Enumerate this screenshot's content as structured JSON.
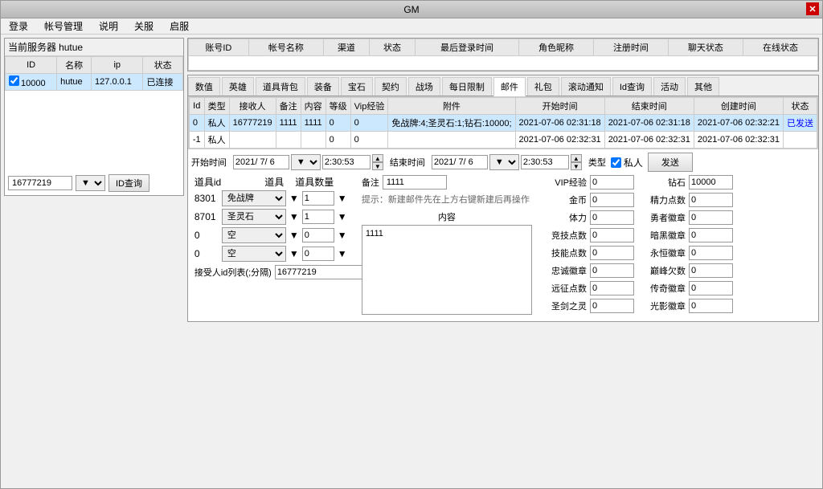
{
  "window": {
    "title": "GM",
    "close_label": "✕"
  },
  "menu": {
    "items": [
      "登录",
      "帐号管理",
      "说明",
      "关服",
      "启服"
    ]
  },
  "left_panel": {
    "server_label": "当前服务器",
    "server_value": "hutue",
    "table": {
      "headers": [
        "ID",
        "名称",
        "ip",
        "状态"
      ],
      "rows": [
        {
          "id": "10000",
          "name": "hutue",
          "ip": "127.0.0.1",
          "status": "已连接"
        }
      ]
    },
    "id_value": "16777219",
    "query_btn": "ID查询"
  },
  "tabs": {
    "items": [
      "数值",
      "英雄",
      "道具背包",
      "装备",
      "宝石",
      "契约",
      "战场",
      "每日限制",
      "邮件",
      "礼包",
      "滚动通知",
      "Id查询",
      "活动",
      "其他"
    ],
    "active": "邮件"
  },
  "mail_table": {
    "headers": [
      "Id",
      "类型",
      "接收人",
      "备注",
      "内容",
      "等级",
      "Vip经验",
      "附件",
      "开始时间",
      "结束时间",
      "创建时间",
      "状态"
    ],
    "rows": [
      {
        "id": "0",
        "type": "私人",
        "receiver": "16777219",
        "remark": "1111",
        "content": "1111",
        "level": "0",
        "vip_exp": "0",
        "attachment": "免战牌:4;圣灵石:1;钻石:10000;",
        "start_time": "2021-07-06 02:31:18",
        "end_time": "2021-07-06 02:31:18",
        "create_time": "2021-07-06 02:32:21",
        "status": "已发送",
        "selected": true
      },
      {
        "id": "-1",
        "type": "私人",
        "receiver": "",
        "remark": "",
        "content": "",
        "level": "0",
        "vip_exp": "0",
        "attachment": "",
        "start_time": "2021-07-06 02:32:31",
        "end_time": "2021-07-06 02:32:31",
        "create_time": "2021-07-06 02:32:31",
        "status": "",
        "selected": false
      }
    ]
  },
  "accounts_table": {
    "headers": [
      "账号ID",
      "帐号名称",
      "渠道",
      "状态",
      "最后登录时间",
      "角色昵称",
      "注册时间",
      "聊天状态",
      "在线状态"
    ]
  },
  "form": {
    "start_time_label": "开始时间",
    "start_date": "2021/ 7/ 6",
    "start_time": "2:30:53",
    "end_time_label": "结束时间",
    "end_date": "2021/ 7/ 6",
    "end_time": "2:30:53",
    "type_label": "类型",
    "private_label": "私人",
    "send_btn": "发送",
    "items_label": "道具id",
    "items_col2": "道具",
    "items_col3": "道具数量",
    "remark_label": "备注",
    "remark_value": "1111",
    "hint": "提示：新建邮件先在上方右键新建后再操作",
    "content_label": "内容",
    "content_value": "1111",
    "recipients_label": "接受人id列表(;分隔)",
    "recipients_value": "16777219",
    "items": [
      {
        "id": "8301",
        "name": "免战牌",
        "count": "1"
      },
      {
        "id": "8701",
        "name": "圣灵石",
        "count": "1"
      },
      {
        "id": "0",
        "name": "空",
        "count": "0"
      },
      {
        "id": "0",
        "name": "空",
        "count": "0"
      }
    ]
  },
  "stats": {
    "vip_exp_label": "VIP经验",
    "vip_exp_value": "0",
    "diamond_label": "钻石",
    "diamond_value": "10000",
    "gold_label": "金币",
    "gold_value": "0",
    "stamina_label": "精力点数",
    "stamina_value": "0",
    "physical_label": "体力",
    "physical_value": "0",
    "brave_badge_label": "勇者徽章",
    "brave_badge_value": "0",
    "arena_label": "竞技点数",
    "arena_value": "0",
    "dark_badge_label": "暗黑徽章",
    "dark_badge_value": "0",
    "skill_label": "技能点数",
    "skill_value": "0",
    "eternal_badge_label": "永恒徽章",
    "eternal_badge_value": "0",
    "loyalty_label": "忠诚徽章",
    "loyalty_value": "0",
    "peak_label": "巅峰欠数",
    "peak_value": "0",
    "expedition_label": "远征点数",
    "expedition_value": "0",
    "legend_badge_label": "传奇徽章",
    "legend_badge_value": "0",
    "holy_sword_label": "圣剑之灵",
    "holy_sword_value": "0",
    "shadow_badge_label": "光影徽章",
    "shadow_badge_value": "0"
  }
}
